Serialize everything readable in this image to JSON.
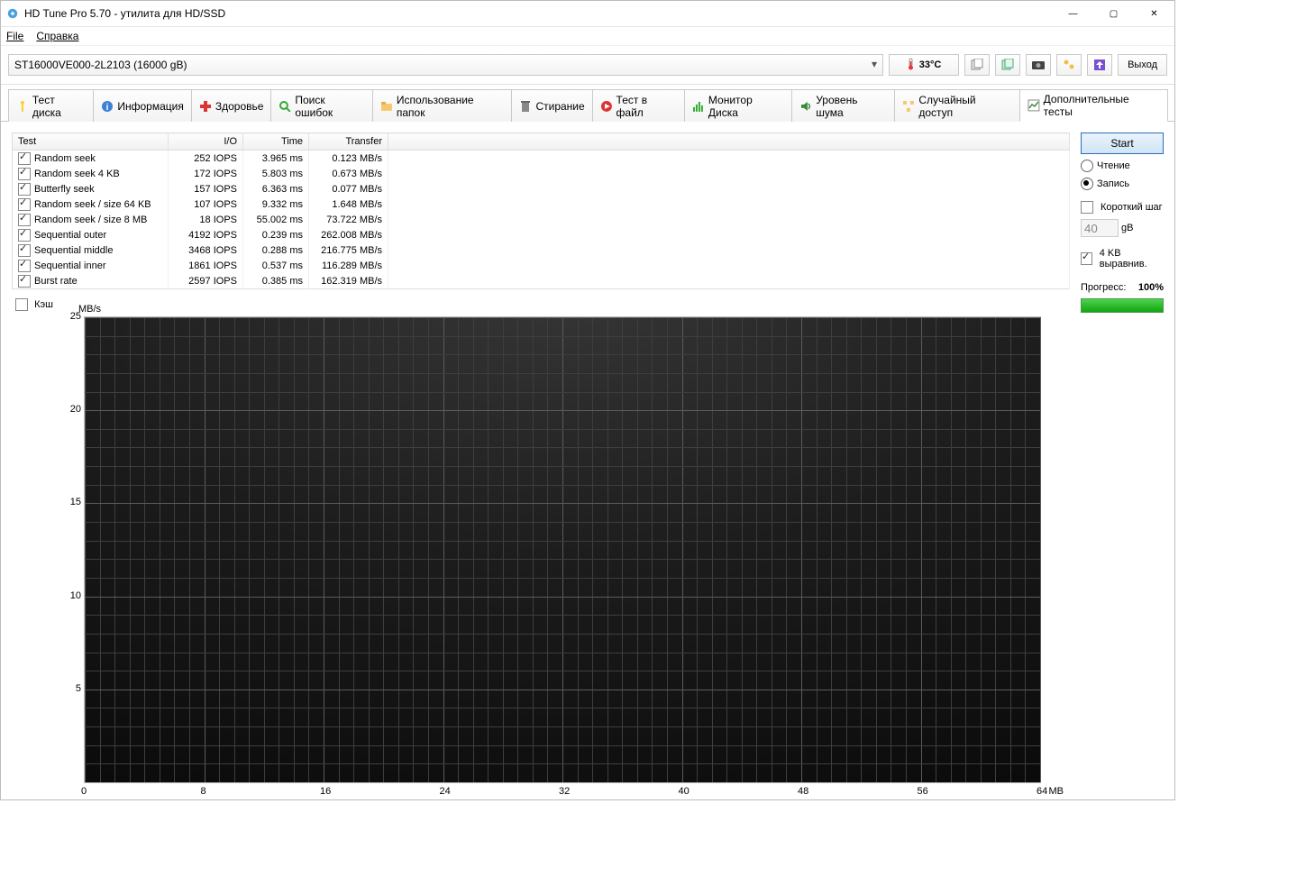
{
  "window": {
    "title": "HD Tune Pro 5.70 - утилита для HD/SSD"
  },
  "menu": {
    "file": "File",
    "help": "Справка"
  },
  "drive": {
    "name": "ST16000VE000-2L2103 (16000 gB)"
  },
  "temp": {
    "value": "33°C"
  },
  "toolbar": {
    "exit": "Выход"
  },
  "tabs": {
    "items": [
      {
        "label": "Тест диска"
      },
      {
        "label": "Информация"
      },
      {
        "label": "Здоровье"
      },
      {
        "label": "Поиск ошибок"
      },
      {
        "label": "Использование папок"
      },
      {
        "label": "Стирание"
      },
      {
        "label": "Тест в файл"
      },
      {
        "label": "Монитор Диска"
      },
      {
        "label": "Уровень шума"
      },
      {
        "label": "Случайный доступ"
      },
      {
        "label": "Дополнительные  тесты"
      }
    ]
  },
  "table": {
    "headers": {
      "test": "Test",
      "io": "I/O",
      "time": "Time",
      "transfer": "Transfer"
    },
    "rows": [
      {
        "name": "Random seek",
        "io": "252 IOPS",
        "time": "3.965 ms",
        "transfer": "0.123 MB/s"
      },
      {
        "name": "Random seek 4 KB",
        "io": "172 IOPS",
        "time": "5.803 ms",
        "transfer": "0.673 MB/s"
      },
      {
        "name": "Butterfly seek",
        "io": "157 IOPS",
        "time": "6.363 ms",
        "transfer": "0.077 MB/s"
      },
      {
        "name": "Random seek / size 64 KB",
        "io": "107 IOPS",
        "time": "9.332 ms",
        "transfer": "1.648 MB/s"
      },
      {
        "name": "Random seek / size 8 MB",
        "io": "18 IOPS",
        "time": "55.002 ms",
        "transfer": "73.722 MB/s"
      },
      {
        "name": "Sequential outer",
        "io": "4192 IOPS",
        "time": "0.239 ms",
        "transfer": "262.008 MB/s"
      },
      {
        "name": "Sequential middle",
        "io": "3468 IOPS",
        "time": "0.288 ms",
        "transfer": "216.775 MB/s"
      },
      {
        "name": "Sequential inner",
        "io": "1861 IOPS",
        "time": "0.537 ms",
        "transfer": "116.289 MB/s"
      },
      {
        "name": "Burst rate",
        "io": "2597 IOPS",
        "time": "0.385 ms",
        "transfer": "162.319 MB/s"
      }
    ]
  },
  "cache": {
    "label": "Кэш"
  },
  "chart_data": {
    "type": "line",
    "ylabel": "MB/s",
    "ylim": [
      0,
      25
    ],
    "yticks": [
      5,
      10,
      15,
      20,
      25
    ],
    "xlim": [
      0,
      64
    ],
    "xticks": [
      0,
      8,
      16,
      24,
      32,
      40,
      48,
      56,
      64
    ],
    "xunit": "MB",
    "series": []
  },
  "side": {
    "start": "Start",
    "read": "Чтение",
    "write": "Запись",
    "short_step": "Короткий шаг",
    "step_value": "40",
    "step_unit": "gB",
    "align4k": "4 KB выравнив.",
    "progress_label": "Прогресс:",
    "progress_value": "100%"
  }
}
